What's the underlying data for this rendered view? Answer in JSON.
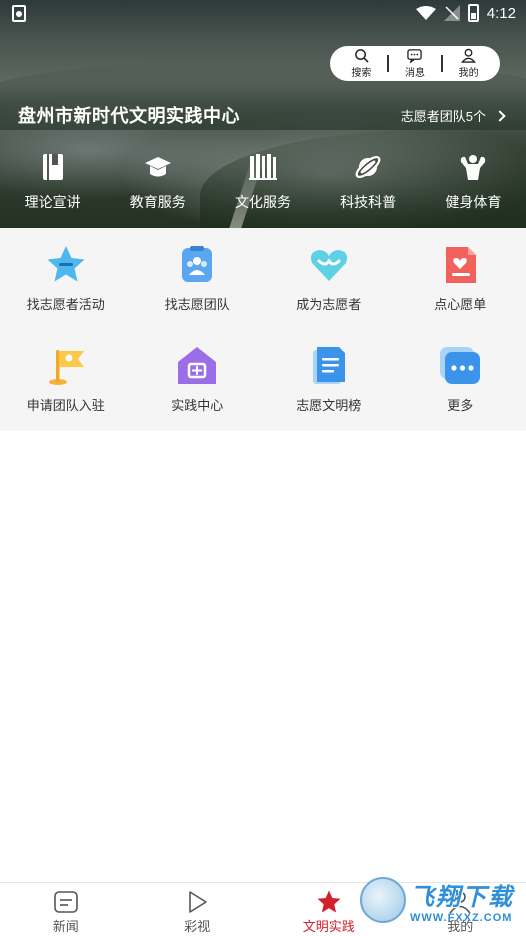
{
  "status_bar": {
    "time": "4:12"
  },
  "top_actions": [
    {
      "label": "搜索",
      "icon": "search-icon"
    },
    {
      "label": "消息",
      "icon": "message-icon"
    },
    {
      "label": "我的",
      "icon": "user-icon"
    }
  ],
  "hero": {
    "title": "盘州市新时代文明实践中心",
    "team_link": "志愿者团队5个"
  },
  "hero_categories": [
    {
      "label": "理论宣讲",
      "icon": "book-icon"
    },
    {
      "label": "教育服务",
      "icon": "graduation-cap-icon"
    },
    {
      "label": "文化服务",
      "icon": "library-icon"
    },
    {
      "label": "科技科普",
      "icon": "planet-icon"
    },
    {
      "label": "健身体育",
      "icon": "muscle-icon"
    }
  ],
  "services": [
    {
      "label": "找志愿者活动",
      "icon": "star-badge-icon"
    },
    {
      "label": "找志愿团队",
      "icon": "team-icon"
    },
    {
      "label": "成为志愿者",
      "icon": "heart-icon"
    },
    {
      "label": "点心愿单",
      "icon": "wish-list-icon"
    },
    {
      "label": "申请团队入驻",
      "icon": "flag-icon"
    },
    {
      "label": "实践中心",
      "icon": "house-icon"
    },
    {
      "label": "志愿文明榜",
      "icon": "document-icon"
    },
    {
      "label": "更多",
      "icon": "more-icon"
    }
  ],
  "bottom_nav": [
    {
      "label": "新闻",
      "icon": "news-icon",
      "active": false
    },
    {
      "label": "彩视",
      "icon": "play-icon",
      "active": false
    },
    {
      "label": "文明实践",
      "icon": "star-icon",
      "active": true
    },
    {
      "label": "我的",
      "icon": "user-icon",
      "active": false
    }
  ],
  "watermark": {
    "title": "飞翔下载",
    "url": "WWW.FXXZ.COM"
  },
  "colors": {
    "accent": "#d4202a",
    "grid_bg": "#f5f5f5"
  }
}
